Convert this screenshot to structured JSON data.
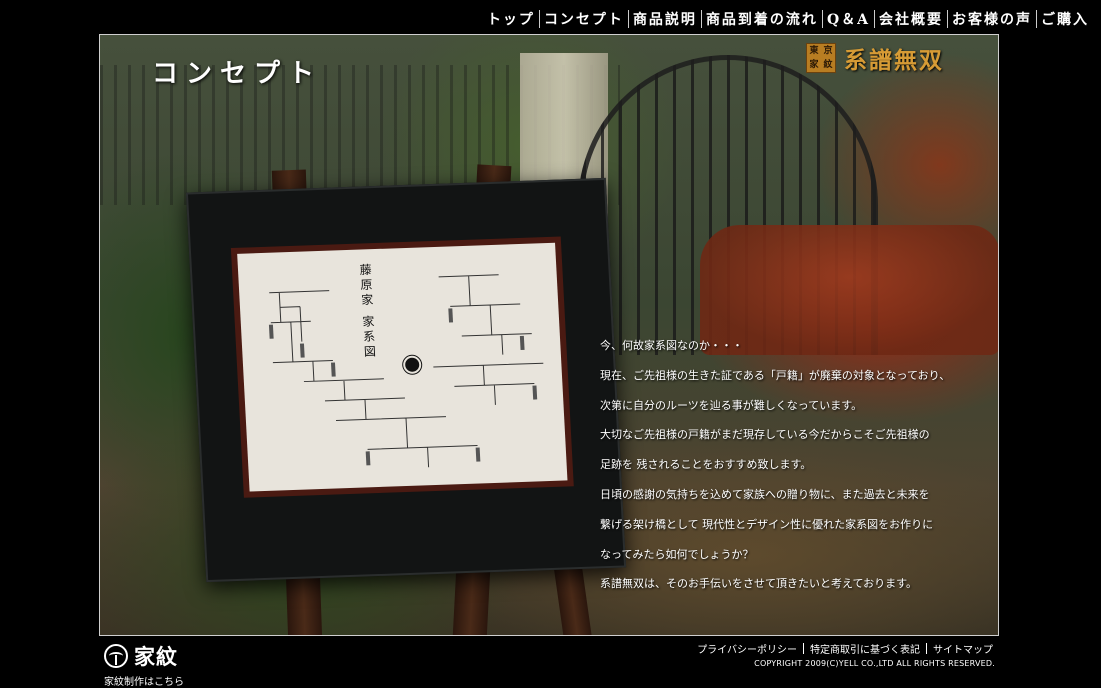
{
  "nav": {
    "items": [
      {
        "label": "トップ"
      },
      {
        "label": "コンセプト"
      },
      {
        "label": "商品説明"
      },
      {
        "label": "商品到着の流れ"
      },
      {
        "label": "Q＆A"
      },
      {
        "label": "会社概要"
      },
      {
        "label": "お客様の声"
      },
      {
        "label": "ご購入"
      }
    ]
  },
  "main": {
    "page_title": "コンセプト",
    "brand": {
      "seal_chars": [
        "東",
        "京",
        "家",
        "紋"
      ],
      "name": "系譜無双"
    },
    "framed_tree_title": "藤原家 家系図",
    "concept_paragraphs": [
      "今、何故家系図なのか・・・",
      "現在、ご先祖様の生きた証である「戸籍」が廃棄の対象となっており、",
      "次第に自分のルーツを辿る事が難しくなっています。",
      "大切なご先祖様の戸籍がまだ現存している今だからこそご先祖様の",
      "足跡を 残されることをおすすめ致します。",
      "日頃の感謝の気持ちを込めて家族への贈り物に、また過去と未来を",
      "繋げる架け橋として 現代性とデザイン性に優れた家系図をお作りに",
      "なってみたら如何でしょうか？",
      "系譜無双は、そのお手伝いをさせて頂きたいと考えております。"
    ]
  },
  "footer": {
    "logo_text": "家紋",
    "logo_caption": "家紋制作はこちら",
    "links": [
      "プライバシーポリシー",
      "特定商取引に基づく表記",
      "サイトマップ"
    ],
    "copyright": "COPYRIGHT 2009(C)YELL CO.,LTD ALL RIGHTS RESERVED."
  },
  "colors": {
    "background": "#000000",
    "brand_gold": "#d69b35",
    "seal_gold": "#b87d22",
    "frame_mat": "#4a1a12"
  }
}
